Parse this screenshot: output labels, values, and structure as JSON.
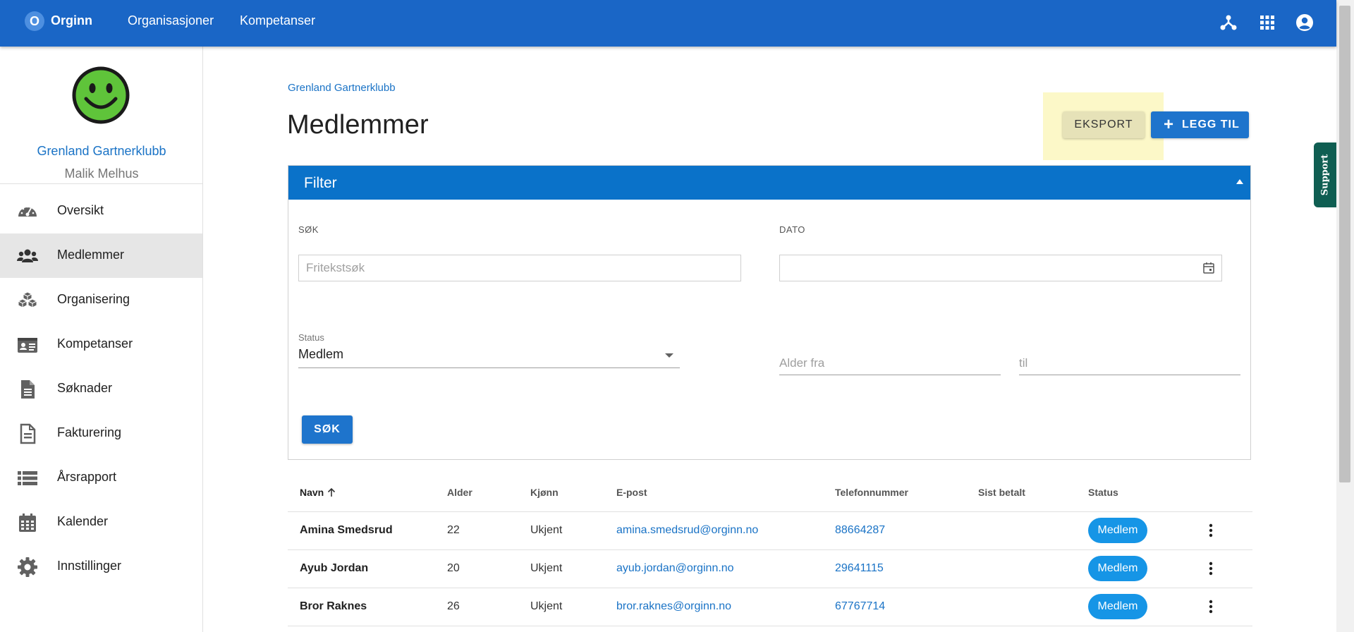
{
  "app": {
    "logo_letter": "O",
    "brand": "Orginn",
    "nav": [
      "Organisasjoner",
      "Kompetanser"
    ]
  },
  "sidebar": {
    "org_name": "Grenland Gartnerklubb",
    "user_name": "Malik Melhus",
    "items": [
      {
        "label": "Oversikt",
        "icon": "dashboard-gauge-icon"
      },
      {
        "label": "Medlemmer",
        "icon": "users-group-icon",
        "active": true
      },
      {
        "label": "Organisering",
        "icon": "cubes-icon"
      },
      {
        "label": "Kompetanser",
        "icon": "id-card-icon"
      },
      {
        "label": "Søknader",
        "icon": "document-icon"
      },
      {
        "label": "Fakturering",
        "icon": "invoice-icon"
      },
      {
        "label": "Årsrapport",
        "icon": "list-icon"
      },
      {
        "label": "Kalender",
        "icon": "calendar-icon"
      },
      {
        "label": "Innstillinger",
        "icon": "gear-icon"
      }
    ]
  },
  "main": {
    "breadcrumb": "Grenland Gartnerklubb",
    "title": "Medlemmer",
    "export_label": "EKSPORT",
    "add_label": "LEGG TIL"
  },
  "filter": {
    "title": "Filter",
    "search_label": "SØK",
    "search_placeholder": "Fritekstsøk",
    "date_label": "DATO",
    "status_label": "Status",
    "status_value": "Medlem",
    "age_from_placeholder": "Alder fra",
    "age_to_placeholder": "til",
    "search_button": "SØK"
  },
  "table": {
    "headers": [
      "Navn",
      "Alder",
      "Kjønn",
      "E-post",
      "Telefonnummer",
      "Sist betalt",
      "Status"
    ],
    "rows": [
      {
        "name": "Amina Smedsrud",
        "age": "22",
        "gender": "Ukjent",
        "email": "amina.smedsrud@orginn.no",
        "phone": "88664287",
        "last_paid": "",
        "status": "Medlem"
      },
      {
        "name": "Ayub Jordan",
        "age": "20",
        "gender": "Ukjent",
        "email": "ayub.jordan@orginn.no",
        "phone": "29641115",
        "last_paid": "",
        "status": "Medlem"
      },
      {
        "name": "Bror Raknes",
        "age": "26",
        "gender": "Ukjent",
        "email": "bror.raknes@orginn.no",
        "phone": "67767714",
        "last_paid": "",
        "status": "Medlem"
      }
    ]
  },
  "support_label": "Support",
  "colors": {
    "primary": "#1a66c6",
    "filter_header": "#0a72c9",
    "badge": "#1695e6",
    "export_highlight": "#fcf8c8",
    "support": "#0f5e52"
  }
}
